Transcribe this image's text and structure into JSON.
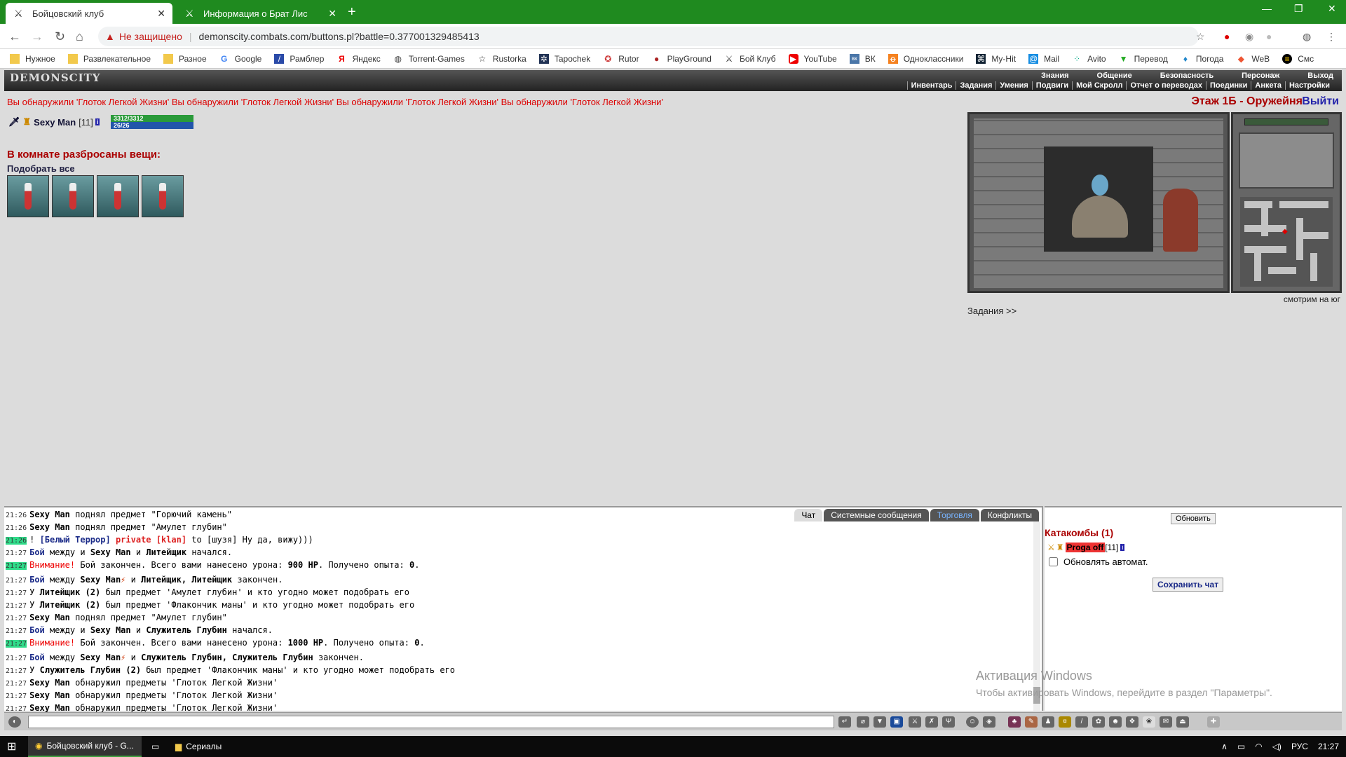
{
  "browser": {
    "tabs": [
      {
        "title": "Бойцовский клуб",
        "active": true
      },
      {
        "title": "Информация о Брат Лис",
        "active": false
      }
    ],
    "address": {
      "security": "Не защищено",
      "url": "demonscity.combats.com/buttons.pl?battle=0.377001329485413"
    },
    "bookmarks": [
      "Нужное",
      "Развлекательное",
      "Разное",
      "Google",
      "Рамблер",
      "Яндекс",
      "Torrent-Games",
      "Rustorka",
      "Tapochek",
      "Rutor",
      "PlayGround",
      "Бой Клуб",
      "YouTube",
      "ВК",
      "Одноклассники",
      "My-Hit",
      "Mail",
      "Avito",
      "Перевод",
      "Погода",
      "WeB",
      "Смс"
    ]
  },
  "game": {
    "logo": "DEMONSCITY",
    "menu_top": [
      "Знания",
      "Общение",
      "Безопасность",
      "Персонаж",
      "Выход"
    ],
    "menu_sub": [
      "Инвентарь",
      "Задания",
      "Умения",
      "Подвиги",
      "Мой Скролл",
      "Отчет о переводах",
      "Поединки",
      "Анкета",
      "Настройки"
    ],
    "found_messages": "Вы обнаружили 'Глоток Легкой Жизни' Вы обнаружили 'Глоток Легкой Жизни' Вы обнаружили 'Глоток Легкой Жизни' Вы обнаружили 'Глоток Легкой Жизни'",
    "location": "Этаж 1Б - Оружейня",
    "exit": "Выйти",
    "player": {
      "name": "Sexy Man",
      "level": "[11]",
      "hp": "3312/3312",
      "mana": "26/26"
    },
    "room_title": "В комнате разбросаны вещи:",
    "pickup_all": "Подобрать все",
    "items_count": 4,
    "looking": "смотрим на юг",
    "tasks": "Задания >>"
  },
  "chat": {
    "tabs": [
      "Чат",
      "Системные сообщения",
      "Торговля",
      "Конфликты"
    ]
  },
  "side": {
    "refresh": "Обновить",
    "catacombs": "Катакомбы (1)",
    "user": "Proga off",
    "user_level": "[11]",
    "auto": "Обновлять автомат.",
    "save": "Сохранить чат"
  },
  "windows": {
    "activation": "Активация Windows",
    "activation_sub": "Чтобы активировать Windows, перейдите в раздел \"Параметры\".",
    "taskbar_items": [
      "Бойцовский клуб - G...",
      "Сериалы"
    ],
    "lang": "РУС",
    "time": "21:27"
  },
  "colors": {
    "chrome_green": "#1f8a1f",
    "hp_green": "#2a9a3a",
    "mana_blue": "#2255aa"
  }
}
